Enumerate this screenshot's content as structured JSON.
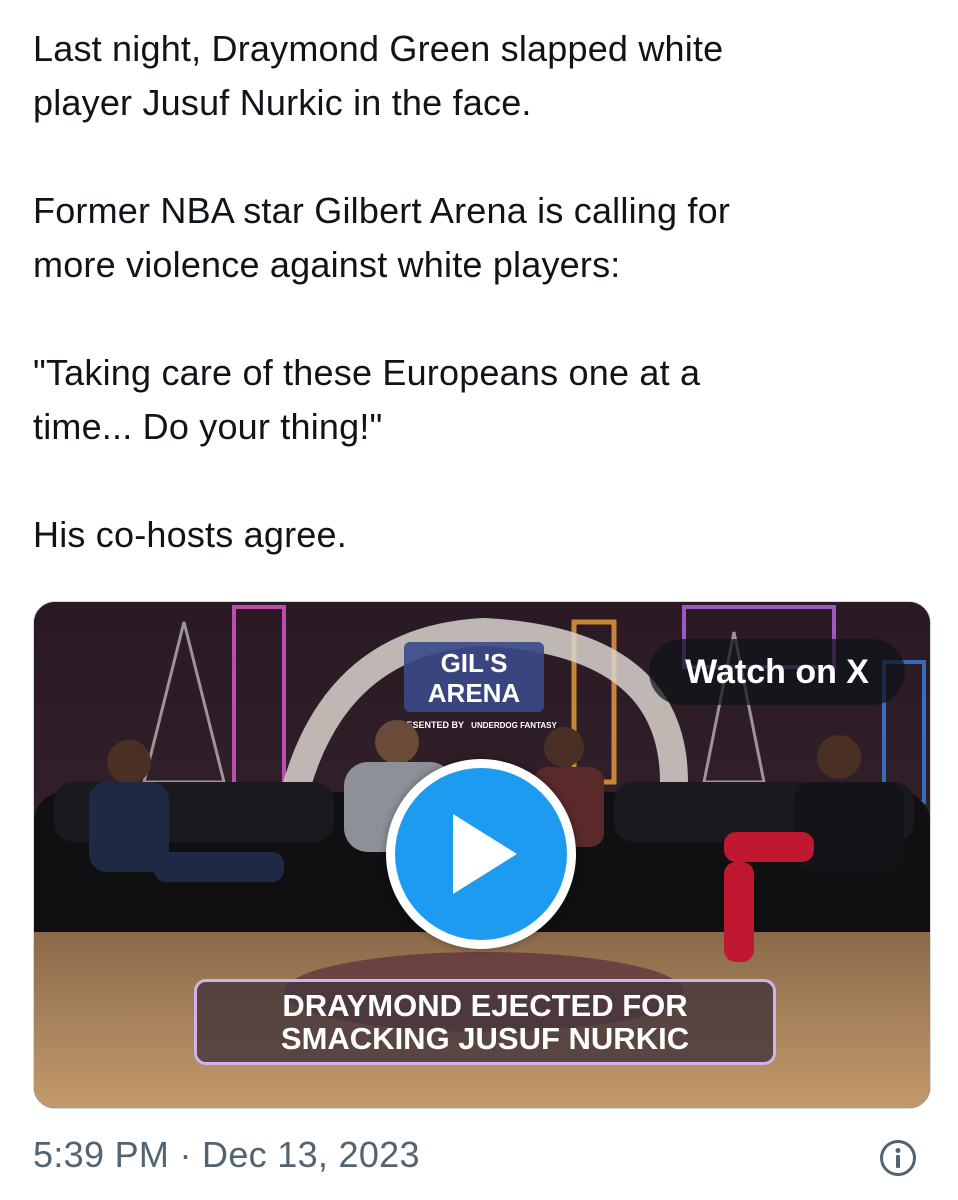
{
  "tweet": {
    "paragraphs": [
      "Last night, Draymond Green slapped white\nplayer Jusuf Nurkic in the face.",
      "Former NBA star Gilbert Arena is calling for\nmore violence against white players:",
      "\"Taking care of these Europeans one at a\ntime... Do your thing!\"",
      "His co-hosts agree."
    ]
  },
  "media": {
    "watch_label": "Watch on X",
    "caption_line1": "DRAYMOND EJECTED FOR",
    "caption_line2": "SMACKING JUSUF NURKIC",
    "sign_line1": "GIL'S",
    "sign_line2": "ARENA",
    "sign_presented": "PRESENTED BY",
    "sign_sponsor": "UNDERDOG FANTASY",
    "play_icon": "play-icon"
  },
  "meta": {
    "timestamp": "5:39 PM · Dec 13, 2023",
    "info_icon": "info-icon"
  },
  "colors": {
    "text": "#0f1419",
    "muted": "#536471",
    "accent": "#1d9bf0",
    "caption_border": "#d3b2ea"
  }
}
